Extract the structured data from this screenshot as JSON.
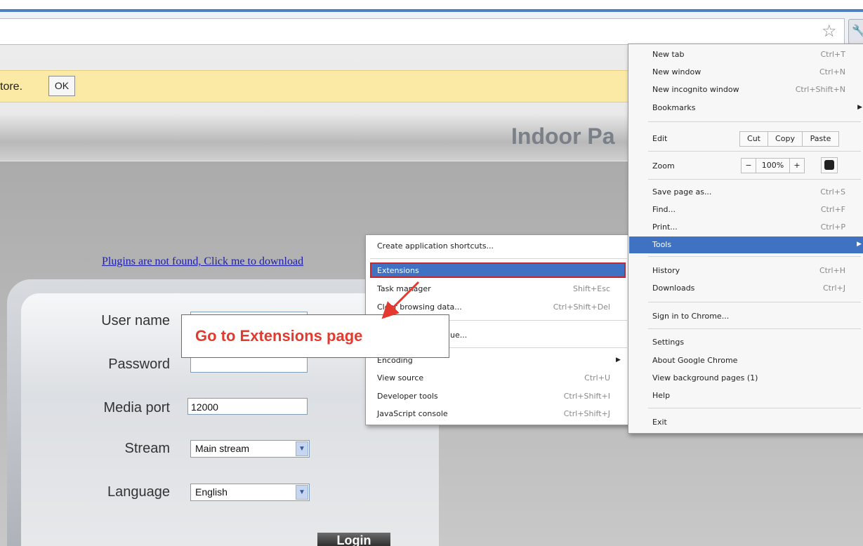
{
  "browser": {
    "star_icon": "star-icon",
    "wrench_icon": "wrench-icon"
  },
  "infobar": {
    "text": "tore.",
    "ok_label": "OK"
  },
  "page": {
    "title": "Indoor Pa",
    "plugins_link": "Plugins are not found, Click me to download"
  },
  "login": {
    "username_label": "User name",
    "username_value": "",
    "password_label": "Password",
    "password_value": "",
    "media_port_label": "Media port",
    "media_port_value": "12000",
    "stream_label": "Stream",
    "stream_value": "Main stream",
    "language_label": "Language",
    "language_value": "English",
    "login_label": "Login"
  },
  "callout": {
    "text": "Go to Extensions page",
    "color": "#e33a2f"
  },
  "chrome_menu": {
    "new_tab": "New tab",
    "new_tab_sc": "Ctrl+T",
    "new_window": "New window",
    "new_window_sc": "Ctrl+N",
    "incognito": "New incognito window",
    "incognito_sc": "Ctrl+Shift+N",
    "bookmarks": "Bookmarks",
    "edit": "Edit",
    "cut": "Cut",
    "copy": "Copy",
    "paste": "Paste",
    "zoom": "Zoom",
    "zoom_minus": "−",
    "zoom_value": "100%",
    "zoom_plus": "+",
    "save_page": "Save page as...",
    "save_page_sc": "Ctrl+S",
    "find": "Find...",
    "find_sc": "Ctrl+F",
    "print": "Print...",
    "print_sc": "Ctrl+P",
    "tools": "Tools",
    "history": "History",
    "history_sc": "Ctrl+H",
    "downloads": "Downloads",
    "downloads_sc": "Ctrl+J",
    "sign_in": "Sign in to Chrome...",
    "settings": "Settings",
    "about": "About Google Chrome",
    "background_pages": "View background pages (1)",
    "help": "Help",
    "exit": "Exit",
    "highlight_color": "#3f72c3"
  },
  "tools_menu": {
    "create_shortcuts": "Create application shortcuts...",
    "extensions": "Extensions",
    "task_manager": "Task manager",
    "task_manager_sc": "Shift+Esc",
    "clear_browsing": "Clear browsing data...",
    "clear_browsing_sc": "Ctrl+Shift+Del",
    "hidden_item": "ue...",
    "encoding": "Encoding",
    "view_source": "View source",
    "view_source_sc": "Ctrl+U",
    "developer_tools": "Developer tools",
    "developer_tools_sc": "Ctrl+Shift+I",
    "js_console": "JavaScript console",
    "js_console_sc": "Ctrl+Shift+J"
  }
}
